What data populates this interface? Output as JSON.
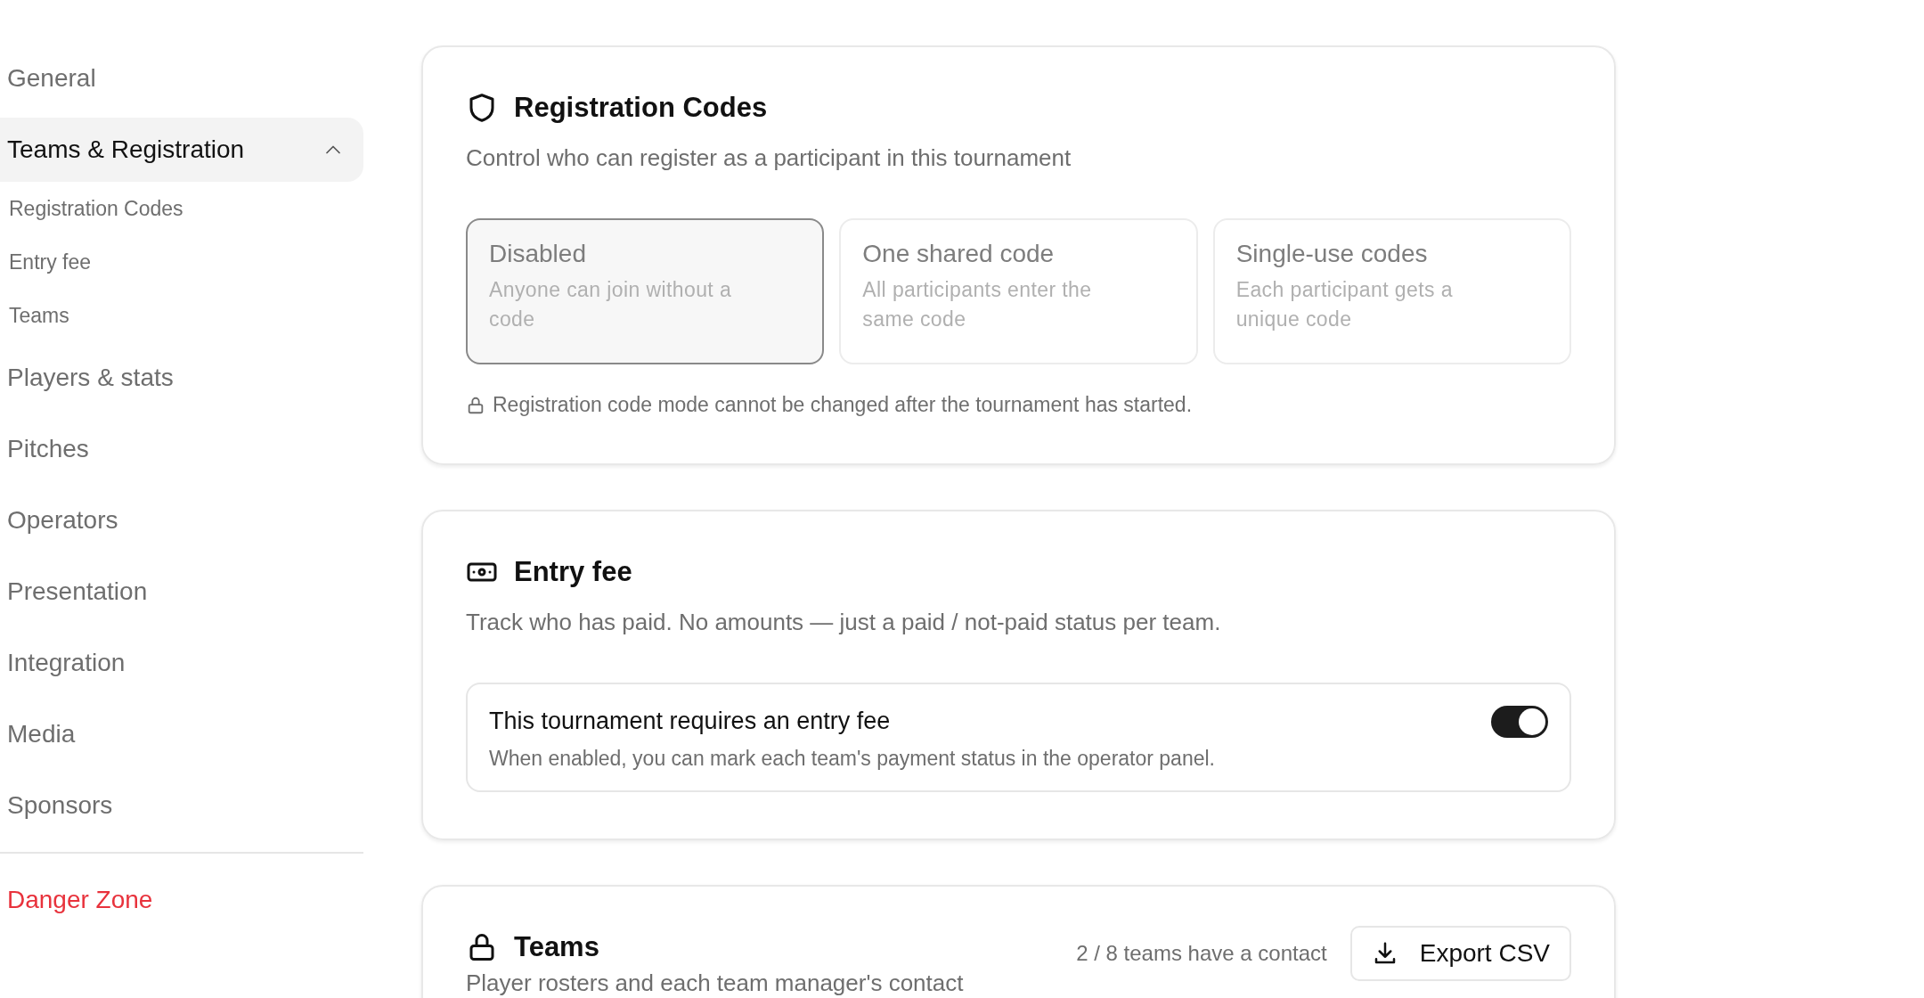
{
  "sidebar": {
    "items": [
      {
        "label": "General",
        "kind": "item",
        "selected": false
      },
      {
        "label": "Teams & Registration",
        "kind": "item",
        "selected": true,
        "expanded": true,
        "children": [
          {
            "label": "Registration Codes"
          },
          {
            "label": "Entry fee"
          },
          {
            "label": "Teams"
          }
        ]
      },
      {
        "label": "Players & stats",
        "kind": "item",
        "selected": false
      },
      {
        "label": "Pitches",
        "kind": "item",
        "selected": false
      },
      {
        "label": "Operators",
        "kind": "item",
        "selected": false
      },
      {
        "label": "Presentation",
        "kind": "item",
        "selected": false
      },
      {
        "label": "Integration",
        "kind": "item",
        "selected": false
      },
      {
        "label": "Media",
        "kind": "item",
        "selected": false
      },
      {
        "label": "Sponsors",
        "kind": "item",
        "selected": false
      },
      {
        "label": "Danger Zone",
        "kind": "danger",
        "selected": false
      }
    ]
  },
  "sections": [
    {
      "kind": "codes",
      "title": "Registration Codes",
      "description": "Control who can register as a participant in this tournament",
      "options": [
        {
          "title": "Disabled",
          "description": "Anyone can join without a code",
          "selected": true,
          "disabled": true
        },
        {
          "title": "One shared code",
          "description": "All participants enter the same code",
          "selected": false,
          "disabled": true
        },
        {
          "title": "Single-use codes",
          "description": "Each participant gets a unique code",
          "selected": false,
          "disabled": true
        }
      ],
      "note": "Registration code mode cannot be changed after the tournament has started."
    },
    {
      "kind": "fee",
      "title": "Entry fee",
      "description": "Track who has paid. No amounts — just a paid / not-paid status per team.",
      "setting": {
        "title": "This tournament requires an entry fee",
        "description": "When enabled, you can mark each team's payment status in the operator panel.",
        "on": true
      }
    },
    {
      "kind": "teams",
      "title": "Teams",
      "description": "Player rosters and each team manager's contact",
      "count": "2 / 8 teams have a contact",
      "button": "Export CSV"
    }
  ]
}
